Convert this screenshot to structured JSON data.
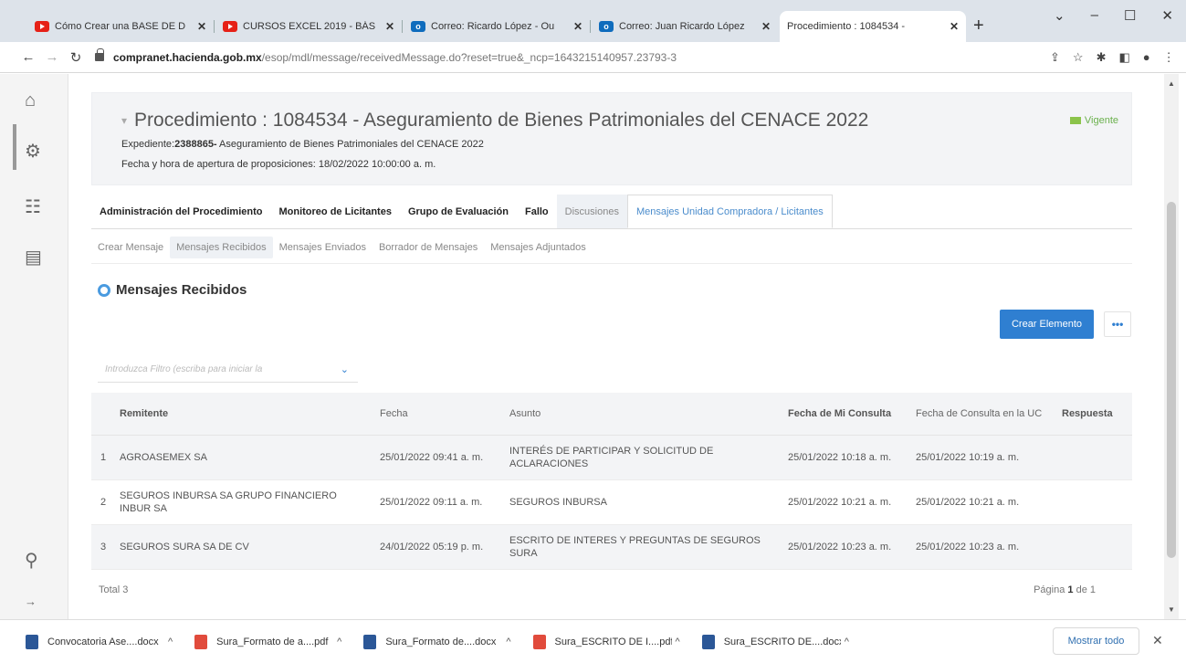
{
  "browser": {
    "tabs": [
      {
        "title": "Cómo Crear una BASE DE D",
        "favicon": "youtube-icon"
      },
      {
        "title": "CURSOS EXCEL 2019 - BÁS",
        "favicon": "youtube-icon"
      },
      {
        "title": "Correo: Ricardo López - Ou",
        "favicon": "outlook-icon"
      },
      {
        "title": "Correo: Juan Ricardo López",
        "favicon": "outlook-icon"
      },
      {
        "title": "Procedimiento : 1084534 -",
        "favicon": ""
      }
    ],
    "url_host": "compranet.hacienda.gob.mx",
    "url_path": "/esop/mdl/message/receivedMessage.do?reset=true&_ncp=1643215140957.23793-3"
  },
  "procedure": {
    "title": "Procedimiento : 1084534 - Aseguramiento de Bienes Patrimoniales del CENACE 2022",
    "expediente_label": "Expediente:",
    "expediente_id": "2388865-",
    "expediente_desc": " Aseguramiento de Bienes Patrimoniales del CENACE 2022",
    "apertura": "Fecha y hora de apertura de proposiciones: 18/02/2022 10:00:00 a. m.",
    "status": "Vigente"
  },
  "tabs_main": [
    "Administración del Procedimiento",
    "Monitoreo de Licitantes",
    "Grupo de Evaluación",
    "Fallo",
    "Discusiones",
    "Mensajes Unidad Compradora / Licitantes"
  ],
  "tabs_sub": [
    "Crear Mensaje",
    "Mensajes Recibidos",
    "Mensajes Enviados",
    "Borrador de Mensajes",
    "Mensajes Adjuntados"
  ],
  "section_title": "Mensajes Recibidos",
  "create_button": "Crear Elemento",
  "more_button": "•••",
  "filter_placeholder": "Introduzca Filtro (escriba para iniciar la",
  "table": {
    "headers": [
      "Remitente",
      "Fecha",
      "Asunto",
      "Fecha de Mi Consulta",
      "Fecha de Consulta en la UC",
      "Respuesta"
    ],
    "rows": [
      {
        "n": "1",
        "remitente": "AGROASEMEX SA",
        "fecha": "25/01/2022 09:41 a. m.",
        "asunto": "INTERÉS DE PARTICIPAR Y SOLICITUD DE ACLARACIONES",
        "consulta": "25/01/2022 10:18 a. m.",
        "consulta_uc": "25/01/2022 10:19 a. m.",
        "respuesta": ""
      },
      {
        "n": "2",
        "remitente": "SEGUROS INBURSA SA GRUPO FINANCIERO INBUR SA",
        "fecha": "25/01/2022 09:11 a. m.",
        "asunto": "SEGUROS INBURSA",
        "consulta": "25/01/2022 10:21 a. m.",
        "consulta_uc": "25/01/2022 10:21 a. m.",
        "respuesta": ""
      },
      {
        "n": "3",
        "remitente": "SEGUROS SURA SA DE CV",
        "fecha": "24/01/2022 05:19 p. m.",
        "asunto": "ESCRITO DE INTERES Y PREGUNTAS DE SEGUROS SURA",
        "consulta": "25/01/2022 10:23 a. m.",
        "consulta_uc": "25/01/2022 10:23 a. m.",
        "respuesta": ""
      }
    ],
    "total": "Total 3",
    "page_label": "Página",
    "page_num": "1",
    "page_of": "de 1"
  },
  "downloads": [
    {
      "name": "Convocatoria Ase....docx",
      "type": "word"
    },
    {
      "name": "Sura_Formato de a....pdf",
      "type": "pdf"
    },
    {
      "name": "Sura_Formato de....docx",
      "type": "word"
    },
    {
      "name": "Sura_ESCRITO DE I....pdf",
      "type": "pdf"
    },
    {
      "name": "Sura_ESCRITO DE....docx",
      "type": "word"
    }
  ],
  "show_all": "Mostrar todo",
  "colors": {
    "accent": "#2f7fd1",
    "status": "#6ab04c"
  }
}
